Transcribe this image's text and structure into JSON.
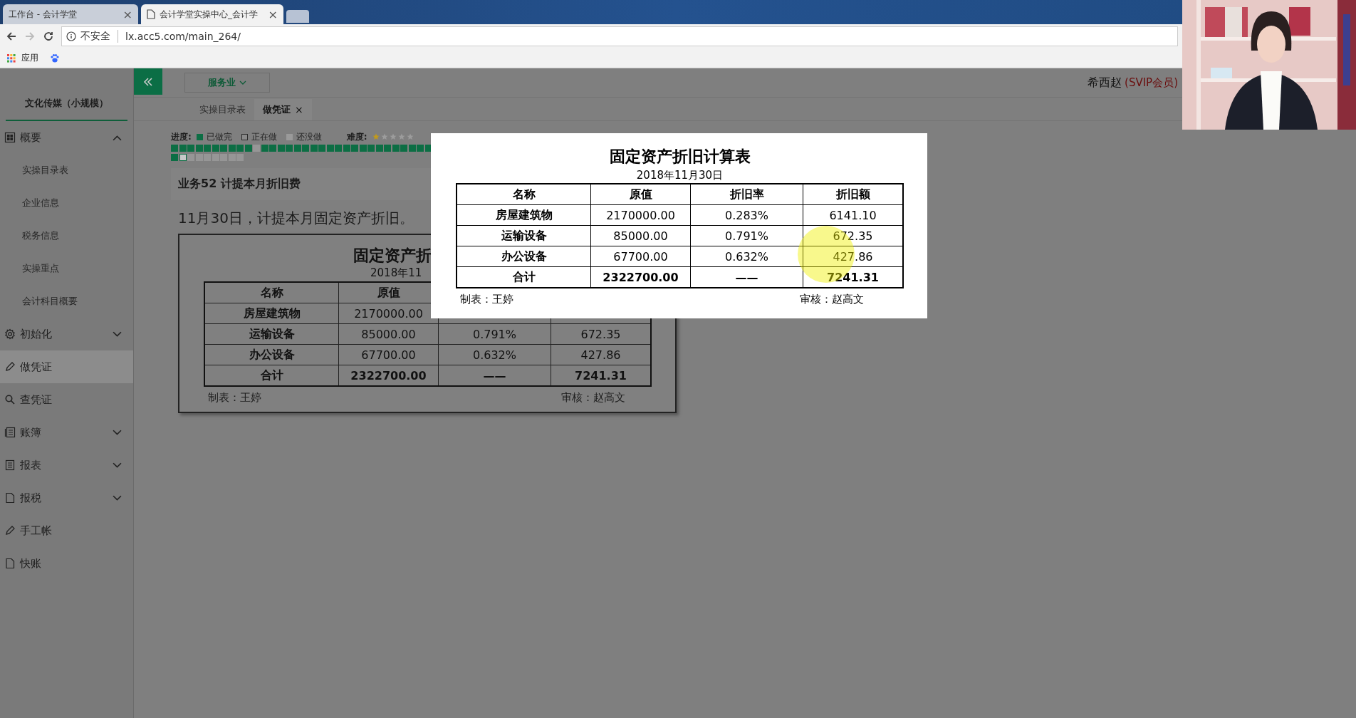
{
  "browser": {
    "tabs": [
      {
        "title": "工作台 - 会计学堂",
        "selected": false,
        "close": "×"
      },
      {
        "title": "会计学堂实操中心_会计学",
        "selected": true,
        "close": "×"
      }
    ],
    "security": "不安全",
    "url": "lx.acc5.com/main_264/",
    "apps_label": "应用"
  },
  "header": {
    "industry": "服务业",
    "user": "希西赵",
    "badge": "(SVIP会员)"
  },
  "sidebar": {
    "company": "文化传媒（小规模）",
    "items": [
      {
        "label": "概要",
        "expanded": true,
        "selected": false,
        "children": [
          {
            "label": "实操目录表"
          },
          {
            "label": "企业信息"
          },
          {
            "label": "税务信息"
          },
          {
            "label": "实操重点"
          },
          {
            "label": "会计科目概要"
          }
        ]
      },
      {
        "label": "初始化",
        "expanded": false,
        "selected": false
      },
      {
        "label": "做凭证",
        "selected": true
      },
      {
        "label": "查凭证",
        "selected": false
      },
      {
        "label": "账簿",
        "expanded": false,
        "selected": false
      },
      {
        "label": "报表",
        "expanded": false,
        "selected": false
      },
      {
        "label": "报税",
        "expanded": false,
        "selected": false
      },
      {
        "label": "手工帐",
        "selected": false
      },
      {
        "label": "快账",
        "selected": false
      }
    ]
  },
  "page_tabs": [
    {
      "label": "实操目录表",
      "selected": false
    },
    {
      "label": "做凭证",
      "selected": true,
      "close": "×"
    }
  ],
  "progress": {
    "label": "进度:",
    "legend": [
      {
        "label": "已做完",
        "kind": "done"
      },
      {
        "label": "正在做",
        "kind": "current"
      },
      {
        "label": "还没做",
        "kind": "todo"
      }
    ],
    "difficulty_label": "难度:",
    "stars": 1,
    "rows": [
      [
        {
          "kind": "done"
        },
        {
          "kind": "done"
        },
        {
          "kind": "done"
        },
        {
          "kind": "done"
        },
        {
          "kind": "done"
        },
        {
          "kind": "done"
        },
        {
          "kind": "done"
        },
        {
          "kind": "done"
        },
        {
          "kind": "done"
        },
        {
          "kind": "done"
        },
        {
          "kind": "todo"
        },
        {
          "kind": "done"
        },
        {
          "kind": "done"
        },
        {
          "kind": "done"
        },
        {
          "kind": "done"
        },
        {
          "kind": "done"
        },
        {
          "kind": "done"
        },
        {
          "kind": "done"
        },
        {
          "kind": "done"
        },
        {
          "kind": "done"
        },
        {
          "kind": "done"
        },
        {
          "kind": "done"
        },
        {
          "kind": "done"
        },
        {
          "kind": "done"
        },
        {
          "kind": "done"
        },
        {
          "kind": "done"
        },
        {
          "kind": "done"
        },
        {
          "kind": "done"
        },
        {
          "kind": "done"
        },
        {
          "kind": "done"
        },
        {
          "kind": "done"
        },
        {
          "kind": "done"
        }
      ],
      [
        {
          "kind": "done"
        },
        {
          "kind": "current"
        },
        {
          "kind": "todo"
        },
        {
          "kind": "todo"
        },
        {
          "kind": "todo"
        },
        {
          "kind": "todo"
        },
        {
          "kind": "todo"
        },
        {
          "kind": "todo"
        },
        {
          "kind": "todo"
        }
      ]
    ]
  },
  "task": {
    "title": "业务52 计提本月折旧费",
    "description": "11月30日，计提本月固定资产折旧。",
    "document": {
      "title": "固定资产折",
      "date": "2018年11",
      "header": [
        "名称",
        "原值"
      ],
      "rows": [
        {
          "cells": [
            "房屋建筑物",
            "2170000.00"
          ],
          "total": false
        },
        {
          "cells": [
            "运输设备",
            "85000.00",
            "0.791%",
            "672.35"
          ],
          "total": false
        },
        {
          "cells": [
            "办公设备",
            "67700.00",
            "0.632%",
            "427.86"
          ],
          "total": false
        },
        {
          "cells": [
            "合计",
            "2322700.00",
            "——",
            "7241.31"
          ],
          "total": true
        }
      ],
      "maker": "制表：王婷",
      "reviewer": "审核：赵高文"
    }
  },
  "modal": {
    "title": "固定资产折旧计算表",
    "date": "2018年11月30日",
    "header": [
      "名称",
      "原值",
      "折旧率",
      "折旧额"
    ],
    "rows": [
      {
        "cells": [
          "房屋建筑物",
          "2170000.00",
          "0.283%",
          "6141.10"
        ],
        "total": false
      },
      {
        "cells": [
          "运输设备",
          "85000.00",
          "0.791%",
          "672.35"
        ],
        "total": false
      },
      {
        "cells": [
          "办公设备",
          "67700.00",
          "0.632%",
          "427.86"
        ],
        "total": false
      },
      {
        "cells": [
          "合计",
          "2322700.00",
          "——",
          "7241.31"
        ],
        "total": true
      }
    ],
    "maker": "制表：王婷",
    "reviewer": "审核：赵高文"
  }
}
